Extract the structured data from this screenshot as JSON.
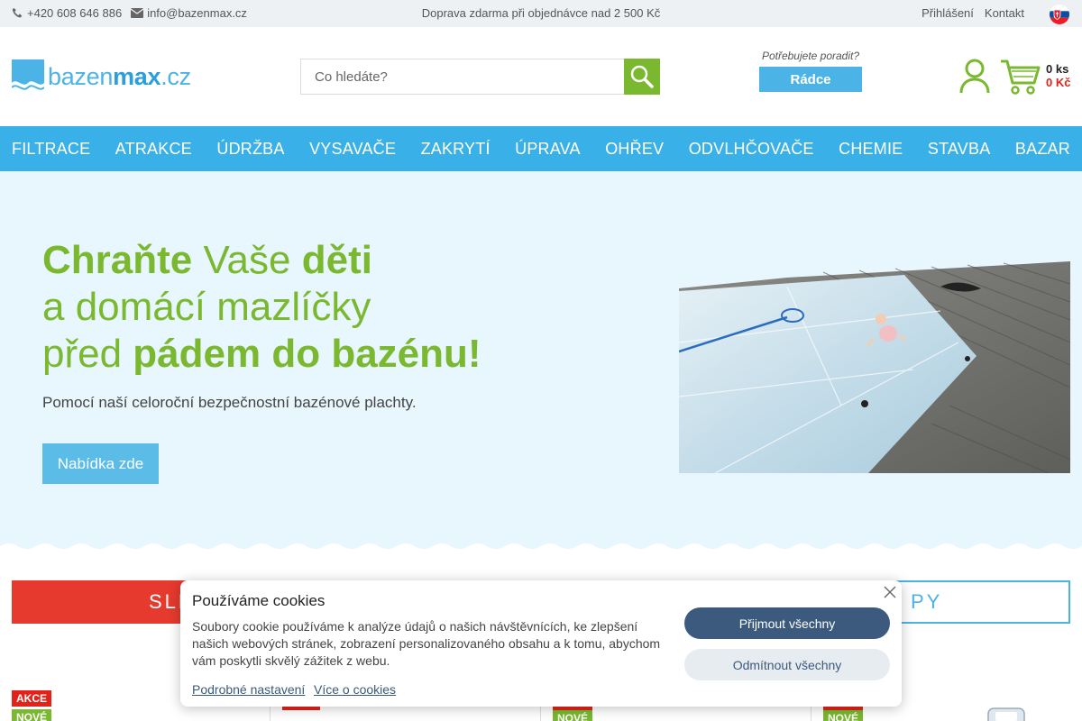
{
  "topbar": {
    "phone": "+420 608 646 886",
    "email": "info@bazenmax.cz",
    "shipping": "Doprava zdarma při objednávce nad 2 500 Kč",
    "login": "Přihlášení",
    "contact": "Kontakt"
  },
  "header": {
    "logo_part1": "bazen",
    "logo_part2": "max",
    "logo_part3": ".cz",
    "search_placeholder": "Co hledáte?",
    "advice_question": "Potřebujete poradit?",
    "advice_button": "Rádce",
    "cart_count": "0 ks",
    "cart_total": "0 Kč"
  },
  "nav": [
    "FILTRACE",
    "ATRAKCE",
    "ÚDRŽBA",
    "VYSAVAČE",
    "ZAKRYTÍ",
    "ÚPRAVA",
    "OHŘEV",
    "ODVLHČOVAČE",
    "CHEMIE",
    "STAVBA",
    "BAZAR"
  ],
  "hero": {
    "line1_bold": "Chraňte",
    "line1_normal": " Vaše ",
    "line1_bold2": "děti",
    "line2": "a domácí mazlíčky",
    "line3_normal": "před ",
    "line3_bold": "pádem do bazénu!",
    "subtitle": "Pomocí naší celoroční bezpečnostní bazénové plachty.",
    "cta": "Nabídka zde"
  },
  "lower": {
    "sale_partial": "SLE",
    "tips_partial": "PY",
    "badge_akce": "AKCE",
    "badge_nove": "NOVÉ"
  },
  "cookie": {
    "title": "Používáme cookies",
    "text": "Soubory cookie používáme k analýze údajů o našich návštěvnících, ke zlepšení našich webových stránek, zobrazení personalizovaného obsahu a k tomu, abychom vám poskytli skvělý zážitek z webu.",
    "detail_link": "Podrobné nastavení",
    "more_link": "Více o cookies",
    "accept": "Přijmout všechny",
    "reject": "Odmítnout všechny"
  },
  "colors": {
    "brand_blue": "#3ab0e8",
    "brand_green": "#7ab82f",
    "sale_red": "#e63a2e",
    "hero_bg": "#e8f6fd",
    "cookie_primary": "#3c5a7d"
  },
  "icons": [
    "phone-icon",
    "mail-icon",
    "slovak-flag-icon",
    "search-icon",
    "user-icon",
    "cart-icon",
    "close-icon",
    "wave-logo-icon"
  ]
}
